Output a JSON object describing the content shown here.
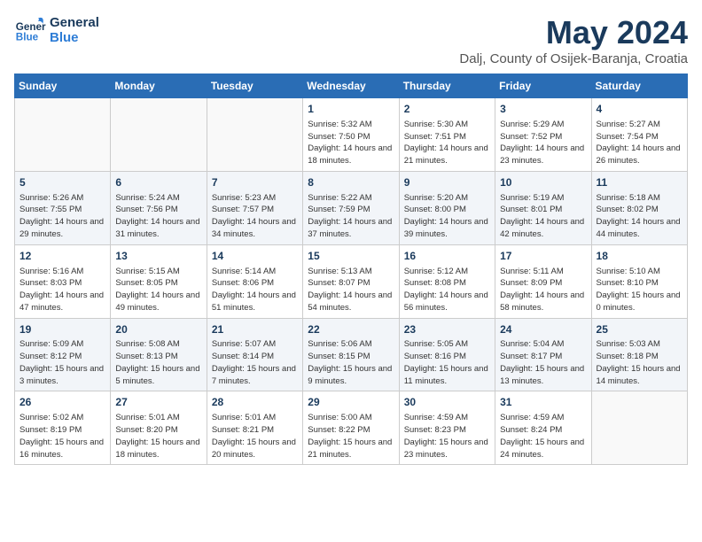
{
  "header": {
    "logo_general": "General",
    "logo_blue": "Blue",
    "title": "May 2024",
    "subtitle": "Dalj, County of Osijek-Baranja, Croatia"
  },
  "days_of_week": [
    "Sunday",
    "Monday",
    "Tuesday",
    "Wednesday",
    "Thursday",
    "Friday",
    "Saturday"
  ],
  "weeks": [
    [
      {
        "day": "",
        "info": ""
      },
      {
        "day": "",
        "info": ""
      },
      {
        "day": "",
        "info": ""
      },
      {
        "day": "1",
        "info": "Sunrise: 5:32 AM\nSunset: 7:50 PM\nDaylight: 14 hours\nand 18 minutes."
      },
      {
        "day": "2",
        "info": "Sunrise: 5:30 AM\nSunset: 7:51 PM\nDaylight: 14 hours\nand 21 minutes."
      },
      {
        "day": "3",
        "info": "Sunrise: 5:29 AM\nSunset: 7:52 PM\nDaylight: 14 hours\nand 23 minutes."
      },
      {
        "day": "4",
        "info": "Sunrise: 5:27 AM\nSunset: 7:54 PM\nDaylight: 14 hours\nand 26 minutes."
      }
    ],
    [
      {
        "day": "5",
        "info": "Sunrise: 5:26 AM\nSunset: 7:55 PM\nDaylight: 14 hours\nand 29 minutes."
      },
      {
        "day": "6",
        "info": "Sunrise: 5:24 AM\nSunset: 7:56 PM\nDaylight: 14 hours\nand 31 minutes."
      },
      {
        "day": "7",
        "info": "Sunrise: 5:23 AM\nSunset: 7:57 PM\nDaylight: 14 hours\nand 34 minutes."
      },
      {
        "day": "8",
        "info": "Sunrise: 5:22 AM\nSunset: 7:59 PM\nDaylight: 14 hours\nand 37 minutes."
      },
      {
        "day": "9",
        "info": "Sunrise: 5:20 AM\nSunset: 8:00 PM\nDaylight: 14 hours\nand 39 minutes."
      },
      {
        "day": "10",
        "info": "Sunrise: 5:19 AM\nSunset: 8:01 PM\nDaylight: 14 hours\nand 42 minutes."
      },
      {
        "day": "11",
        "info": "Sunrise: 5:18 AM\nSunset: 8:02 PM\nDaylight: 14 hours\nand 44 minutes."
      }
    ],
    [
      {
        "day": "12",
        "info": "Sunrise: 5:16 AM\nSunset: 8:03 PM\nDaylight: 14 hours\nand 47 minutes."
      },
      {
        "day": "13",
        "info": "Sunrise: 5:15 AM\nSunset: 8:05 PM\nDaylight: 14 hours\nand 49 minutes."
      },
      {
        "day": "14",
        "info": "Sunrise: 5:14 AM\nSunset: 8:06 PM\nDaylight: 14 hours\nand 51 minutes."
      },
      {
        "day": "15",
        "info": "Sunrise: 5:13 AM\nSunset: 8:07 PM\nDaylight: 14 hours\nand 54 minutes."
      },
      {
        "day": "16",
        "info": "Sunrise: 5:12 AM\nSunset: 8:08 PM\nDaylight: 14 hours\nand 56 minutes."
      },
      {
        "day": "17",
        "info": "Sunrise: 5:11 AM\nSunset: 8:09 PM\nDaylight: 14 hours\nand 58 minutes."
      },
      {
        "day": "18",
        "info": "Sunrise: 5:10 AM\nSunset: 8:10 PM\nDaylight: 15 hours\nand 0 minutes."
      }
    ],
    [
      {
        "day": "19",
        "info": "Sunrise: 5:09 AM\nSunset: 8:12 PM\nDaylight: 15 hours\nand 3 minutes."
      },
      {
        "day": "20",
        "info": "Sunrise: 5:08 AM\nSunset: 8:13 PM\nDaylight: 15 hours\nand 5 minutes."
      },
      {
        "day": "21",
        "info": "Sunrise: 5:07 AM\nSunset: 8:14 PM\nDaylight: 15 hours\nand 7 minutes."
      },
      {
        "day": "22",
        "info": "Sunrise: 5:06 AM\nSunset: 8:15 PM\nDaylight: 15 hours\nand 9 minutes."
      },
      {
        "day": "23",
        "info": "Sunrise: 5:05 AM\nSunset: 8:16 PM\nDaylight: 15 hours\nand 11 minutes."
      },
      {
        "day": "24",
        "info": "Sunrise: 5:04 AM\nSunset: 8:17 PM\nDaylight: 15 hours\nand 13 minutes."
      },
      {
        "day": "25",
        "info": "Sunrise: 5:03 AM\nSunset: 8:18 PM\nDaylight: 15 hours\nand 14 minutes."
      }
    ],
    [
      {
        "day": "26",
        "info": "Sunrise: 5:02 AM\nSunset: 8:19 PM\nDaylight: 15 hours\nand 16 minutes."
      },
      {
        "day": "27",
        "info": "Sunrise: 5:01 AM\nSunset: 8:20 PM\nDaylight: 15 hours\nand 18 minutes."
      },
      {
        "day": "28",
        "info": "Sunrise: 5:01 AM\nSunset: 8:21 PM\nDaylight: 15 hours\nand 20 minutes."
      },
      {
        "day": "29",
        "info": "Sunrise: 5:00 AM\nSunset: 8:22 PM\nDaylight: 15 hours\nand 21 minutes."
      },
      {
        "day": "30",
        "info": "Sunrise: 4:59 AM\nSunset: 8:23 PM\nDaylight: 15 hours\nand 23 minutes."
      },
      {
        "day": "31",
        "info": "Sunrise: 4:59 AM\nSunset: 8:24 PM\nDaylight: 15 hours\nand 24 minutes."
      },
      {
        "day": "",
        "info": ""
      }
    ]
  ]
}
